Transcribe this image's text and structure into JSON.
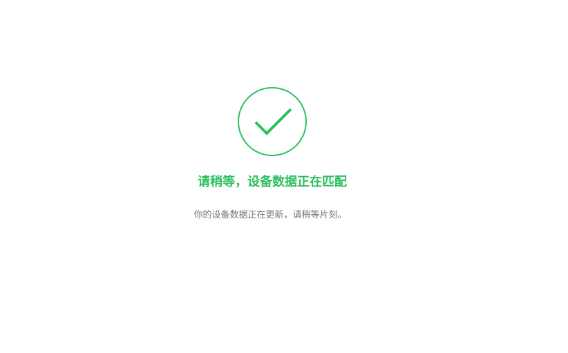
{
  "status": {
    "icon": "checkmark-circle-icon",
    "title": "请稍等，设备数据正在匹配",
    "message": "你的设备数据正在更新，请稍等片刻。"
  },
  "colors": {
    "accent": "#2dbe60",
    "message_text": "#777777",
    "background": "#ffffff"
  }
}
